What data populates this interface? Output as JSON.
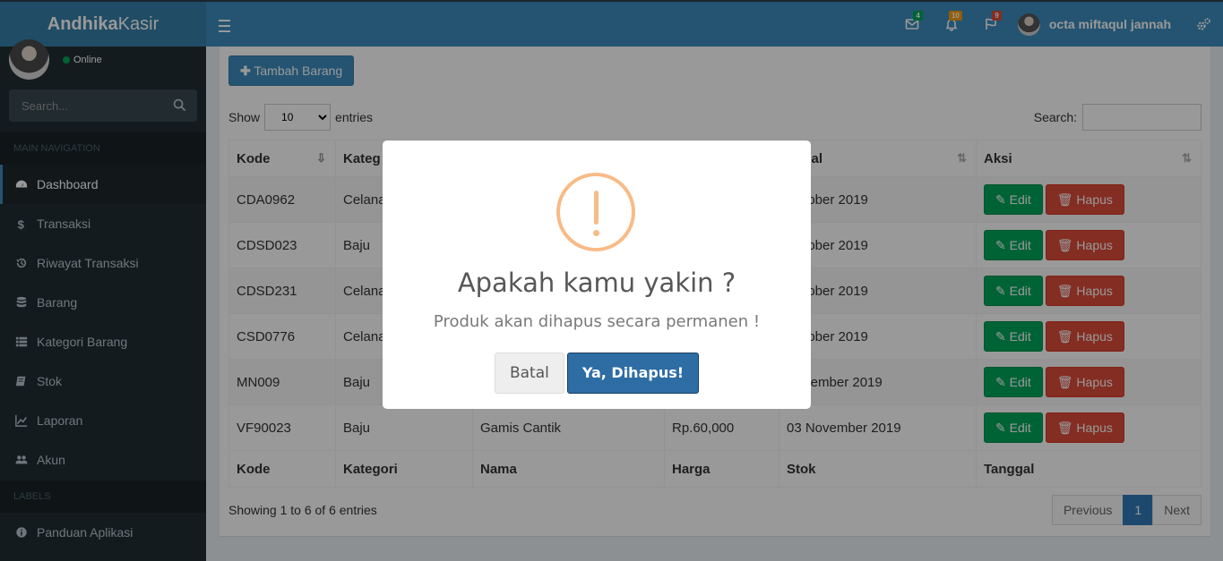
{
  "header": {
    "logo_bold": "Andhika",
    "logo_rest": "Kasir",
    "mail_count": "4",
    "notif_count": "10",
    "flag_count": "9",
    "user_name": "octa miftaqul jannah",
    "colors": {
      "mail_badge": "#00a65a",
      "notif_badge": "#f39c12",
      "flag_badge": "#dd4b39"
    }
  },
  "sidebar": {
    "status": "Online",
    "search_placeholder": "Search...",
    "main_nav_header": "MAIN NAVIGATION",
    "labels_header": "LABELS",
    "items": [
      {
        "label": "Dashboard",
        "icon": "dashboard-icon"
      },
      {
        "label": "Transaksi",
        "icon": "dollar-icon"
      },
      {
        "label": "Riwayat Transaksi",
        "icon": "history-icon"
      },
      {
        "label": "Barang",
        "icon": "database-icon"
      },
      {
        "label": "Kategori Barang",
        "icon": "list-icon"
      },
      {
        "label": "Stok",
        "icon": "book-icon"
      },
      {
        "label": "Laporan",
        "icon": "chart-icon"
      },
      {
        "label": "Akun",
        "icon": "users-icon"
      }
    ],
    "panduan": "Panduan Aplikasi"
  },
  "content": {
    "add_button": "Tambah Barang",
    "show_label": "Show",
    "entries_label": "entries",
    "page_size": "10",
    "search_label": "Search:",
    "columns": [
      "Kode",
      "Kategori",
      "Nama",
      "Harga",
      "Tanggal",
      "Aksi"
    ],
    "header_visible": [
      "Kode",
      "Kateg",
      "",
      "",
      "nggal",
      "Aksi"
    ],
    "footer_columns": [
      "Kode",
      "Kategori",
      "Nama",
      "Harga",
      "Stok",
      "Tanggal"
    ],
    "rows": [
      {
        "kode": "CDA0962",
        "kategori": "Celana",
        "nama": "",
        "harga": "",
        "tanggal": "Oktober 2019"
      },
      {
        "kode": "CDSD023",
        "kategori": "Baju",
        "nama": "",
        "harga": "",
        "tanggal": "Oktober 2019"
      },
      {
        "kode": "CDSD231",
        "kategori": "Celana",
        "nama": "",
        "harga": "",
        "tanggal": "Oktober 2019"
      },
      {
        "kode": "CSD0776",
        "kategori": "Celana",
        "nama": "",
        "harga": "",
        "tanggal": "Oktober 2019"
      },
      {
        "kode": "MN009",
        "kategori": "Baju",
        "nama": "",
        "harga": "",
        "tanggal": "November 2019"
      },
      {
        "kode": "VF90023",
        "kategori": "Baju",
        "nama": "Gamis Cantik",
        "harga": "Rp.60,000",
        "tanggal": "03 November 2019"
      }
    ],
    "edit_label": "Edit",
    "delete_label": "Hapus",
    "info": "Showing 1 to 6 of 6 entries",
    "prev": "Previous",
    "page": "1",
    "next": "Next"
  },
  "modal": {
    "title": "Apakah kamu yakin ?",
    "text": "Produk akan dihapus secara permanen !",
    "cancel": "Batal",
    "confirm": "Ya, Dihapus!"
  }
}
